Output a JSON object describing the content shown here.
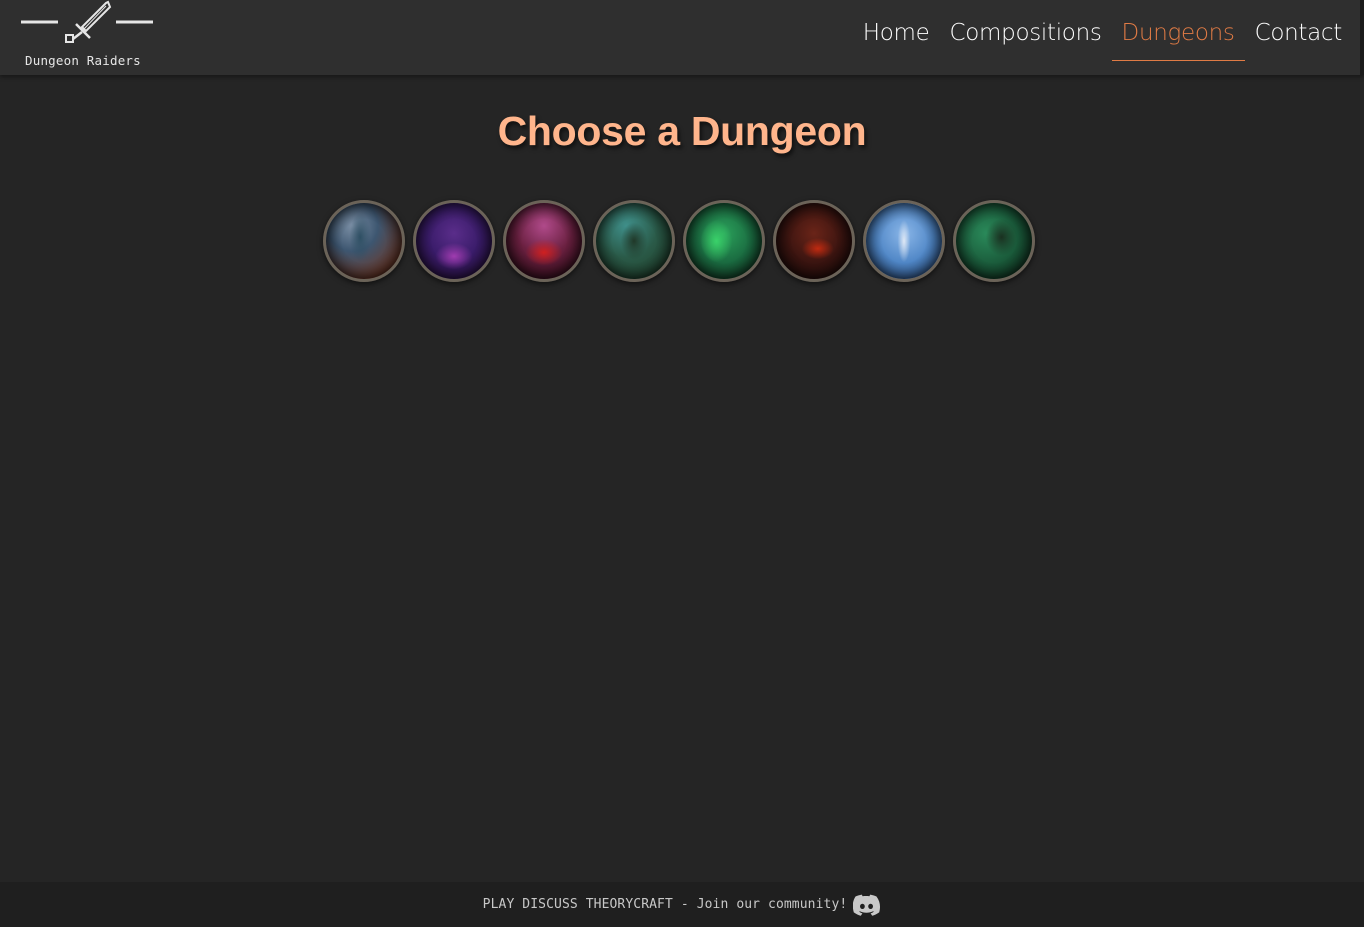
{
  "brand": {
    "name": "Dungeon Raiders",
    "logo_icon": "sword-icon"
  },
  "nav": {
    "items": [
      {
        "label": "Home",
        "active": false
      },
      {
        "label": "Compositions",
        "active": false
      },
      {
        "label": "Dungeons",
        "active": true
      },
      {
        "label": "Contact",
        "active": false
      }
    ],
    "accent_color": "#e07b45"
  },
  "main": {
    "title": "Choose a Dungeon",
    "title_color": "#ffb58c",
    "dungeon_count": 8
  },
  "footer": {
    "text": "PLAY DISCUSS THEORYCRAFT - Join our community!",
    "icon": "discord-icon"
  }
}
